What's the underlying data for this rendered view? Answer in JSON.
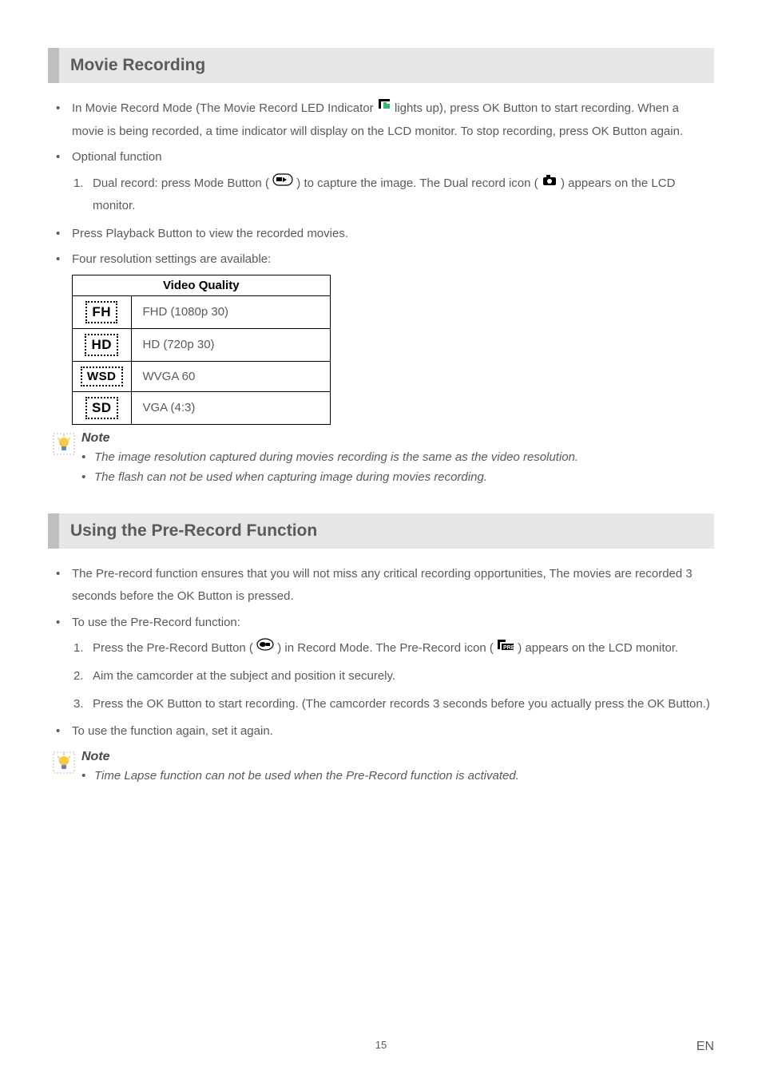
{
  "sections": {
    "movie": {
      "title": "Movie Recording",
      "b1_a": "In Movie Record Mode (The Movie Record LED Indicator ",
      "b1_b": " lights up), press OK Button to start recording. When a movie is being recorded, a time indicator will display on the LCD monitor. To stop recording, press OK Button again.",
      "b2": "Optional function",
      "b2_1_a": "Dual record: press Mode Button (",
      "b2_1_b": ") to capture the image. The Dual record icon ( ",
      "b2_1_c": " ) appears on the LCD monitor.",
      "b3": "Press Playback Button to view the recorded movies.",
      "b4": "Four resolution settings are available:",
      "table_header": "Video Quality",
      "rows": [
        {
          "icon": "FH",
          "label": "FHD (1080p 30)"
        },
        {
          "icon": "HD",
          "label": "HD (720p 30)"
        },
        {
          "icon": "WSD",
          "label": "WVGA 60"
        },
        {
          "icon": "SD",
          "label": "VGA (4:3)"
        }
      ],
      "note_title": "Note",
      "note1": "The image resolution captured during movies recording is the same as the video resolution.",
      "note2": "The flash can not be used when capturing image during movies recording."
    },
    "prerecord": {
      "title": "Using the Pre-Record Function",
      "b1": "The Pre-record function ensures that you will not miss any critical recording opportunities, The movies are recorded 3 seconds before the OK Button is pressed.",
      "b2": "To use the Pre-Record function:",
      "b2_1_a": "Press the Pre-Record Button (",
      "b2_1_b": ") in Record Mode. The Pre-Record icon ( ",
      "b2_1_c": " ) appears on the LCD monitor.",
      "b2_2": "Aim the camcorder at the subject and position it securely.",
      "b2_3": "Press the OK Button to start recording. (The camcorder records 3 seconds before you actually press the OK Button.)",
      "b3": "To use the function again, set it again.",
      "note_title": "Note",
      "note1": "Time Lapse function can not be used when the Pre-Record function is activated."
    }
  },
  "page_number": "15",
  "lang": "EN",
  "icon_names": {
    "movie_led": "movie-indicator-icon",
    "mode_button": "mode-button-icon",
    "dual_record": "dual-record-icon",
    "lightbulb": "lightbulb-note-icon",
    "prerecord_button": "prerecord-button-icon",
    "prerecord_indicator": "prerecord-indicator-icon"
  }
}
